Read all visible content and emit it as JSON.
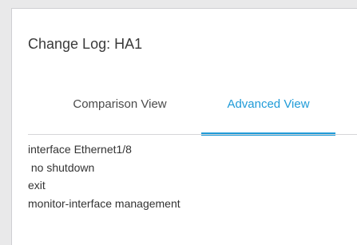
{
  "dialog": {
    "title": "Change Log: HA1"
  },
  "tabs": [
    {
      "label": "Comparison View",
      "active": false
    },
    {
      "label": "Advanced View",
      "active": true
    }
  ],
  "config_lines": [
    "interface Ethernet1/8",
    " no shutdown",
    "exit",
    "monitor-interface management"
  ],
  "colors": {
    "accent": "#1f9bd8",
    "text": "#333333"
  }
}
